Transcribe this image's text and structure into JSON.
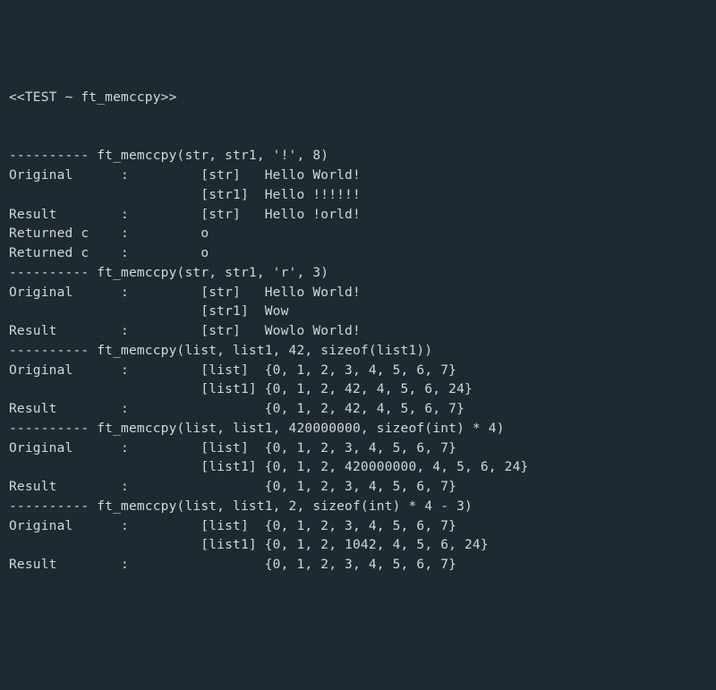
{
  "header": "<<TEST ~ ft_memccpy>>",
  "blank": "",
  "sep": "----------",
  "tests": [
    {
      "call": "ft_memccpy(str, str1, '!', 8)",
      "rows": [
        {
          "label": "Original",
          "tag": "[str]",
          "value": "Hello World!"
        },
        {
          "label": "",
          "tag": "[str1]",
          "value": "Hello !!!!!!"
        },
        {
          "label": "Result",
          "tag": "[str]",
          "value": "Hello !orld!"
        },
        {
          "label": "Returned c",
          "tag": "",
          "value": "o"
        },
        {
          "label": "",
          "tag": "",
          "value": ""
        },
        {
          "label": "Returned c",
          "tag": "",
          "value": "o"
        }
      ]
    },
    {
      "call": "ft_memccpy(str, str1, 'r', 3)",
      "rows": [
        {
          "label": "Original",
          "tag": "[str]",
          "value": "Hello World!"
        },
        {
          "label": "",
          "tag": "[str1]",
          "value": "Wow"
        },
        {
          "label": "Result",
          "tag": "[str]",
          "value": "Wowlo World!"
        },
        {
          "label": "",
          "tag": "",
          "value": ""
        }
      ]
    },
    {
      "call": "ft_memccpy(list, list1, 42, sizeof(list1))",
      "rows": [
        {
          "label": "Original",
          "tag": "[list]",
          "value": "{0, 1, 2, 3, 4, 5, 6, 7}"
        },
        {
          "label": "",
          "tag": "[list1]",
          "value": "{0, 1, 2, 42, 4, 5, 6, 24}"
        },
        {
          "label": "Result",
          "tag": "",
          "value": "{0, 1, 2, 42, 4, 5, 6, 7}"
        },
        {
          "label": "",
          "tag": "",
          "value": ""
        }
      ]
    },
    {
      "call": "ft_memccpy(list, list1, 420000000, sizeof(int) * 4)",
      "rows": [
        {
          "label": "Original",
          "tag": "[list]",
          "value": "{0, 1, 2, 3, 4, 5, 6, 7}"
        },
        {
          "label": "",
          "tag": "[list1]",
          "value": "{0, 1, 2, 420000000, 4, 5, 6, 24}"
        },
        {
          "label": "Result",
          "tag": "",
          "value": "{0, 1, 2, 3, 4, 5, 6, 7}"
        },
        {
          "label": "",
          "tag": "",
          "value": ""
        }
      ]
    },
    {
      "call": "ft_memccpy(list, list1, 2, sizeof(int) * 4 - 3)",
      "rows": [
        {
          "label": "Original",
          "tag": "[list]",
          "value": "{0, 1, 2, 3, 4, 5, 6, 7}"
        },
        {
          "label": "",
          "tag": "[list1]",
          "value": "{0, 1, 2, 1042, 4, 5, 6, 24}"
        },
        {
          "label": "Result",
          "tag": "",
          "value": "{0, 1, 2, 3, 4, 5, 6, 7}"
        }
      ]
    }
  ]
}
